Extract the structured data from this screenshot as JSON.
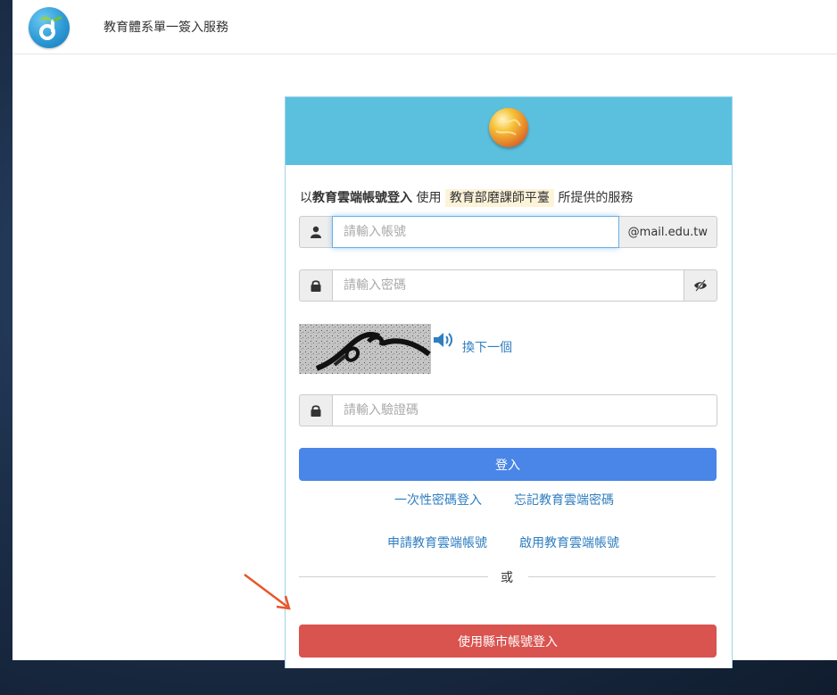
{
  "app": {
    "title": "教育體系單一簽入服務"
  },
  "intro": {
    "prefix": "以",
    "account_type": "教育雲端帳號登入",
    "middle": " 使用 ",
    "service_name": "教育部磨課師平臺",
    "suffix": " 所提供的服務"
  },
  "form": {
    "username_placeholder": "請輸入帳號",
    "domain_suffix": "@mail.edu.tw",
    "password_placeholder": "請輸入密碼",
    "captcha_refresh_label": "換下一個",
    "captcha_placeholder": "請輸入驗證碼",
    "login_button": "登入"
  },
  "links": {
    "otp_login": "一次性密碼登入",
    "forgot_password": "忘記教育雲端密碼",
    "apply_account": "申請教育雲端帳號",
    "activate_account": "啟用教育雲端帳號"
  },
  "divider": {
    "or": "或"
  },
  "city_login_button": "使用縣市帳號登入",
  "colors": {
    "header": "#5bc0de",
    "primary": "#4a85e8",
    "danger": "#d9534f",
    "link": "#2f7ec0",
    "annotation_arrow": "#e8562a"
  },
  "icons": [
    "app-logo",
    "globe-icon",
    "user-icon",
    "lock-icon",
    "eye-slash-icon",
    "speaker-icon",
    "annotation-arrow"
  ]
}
